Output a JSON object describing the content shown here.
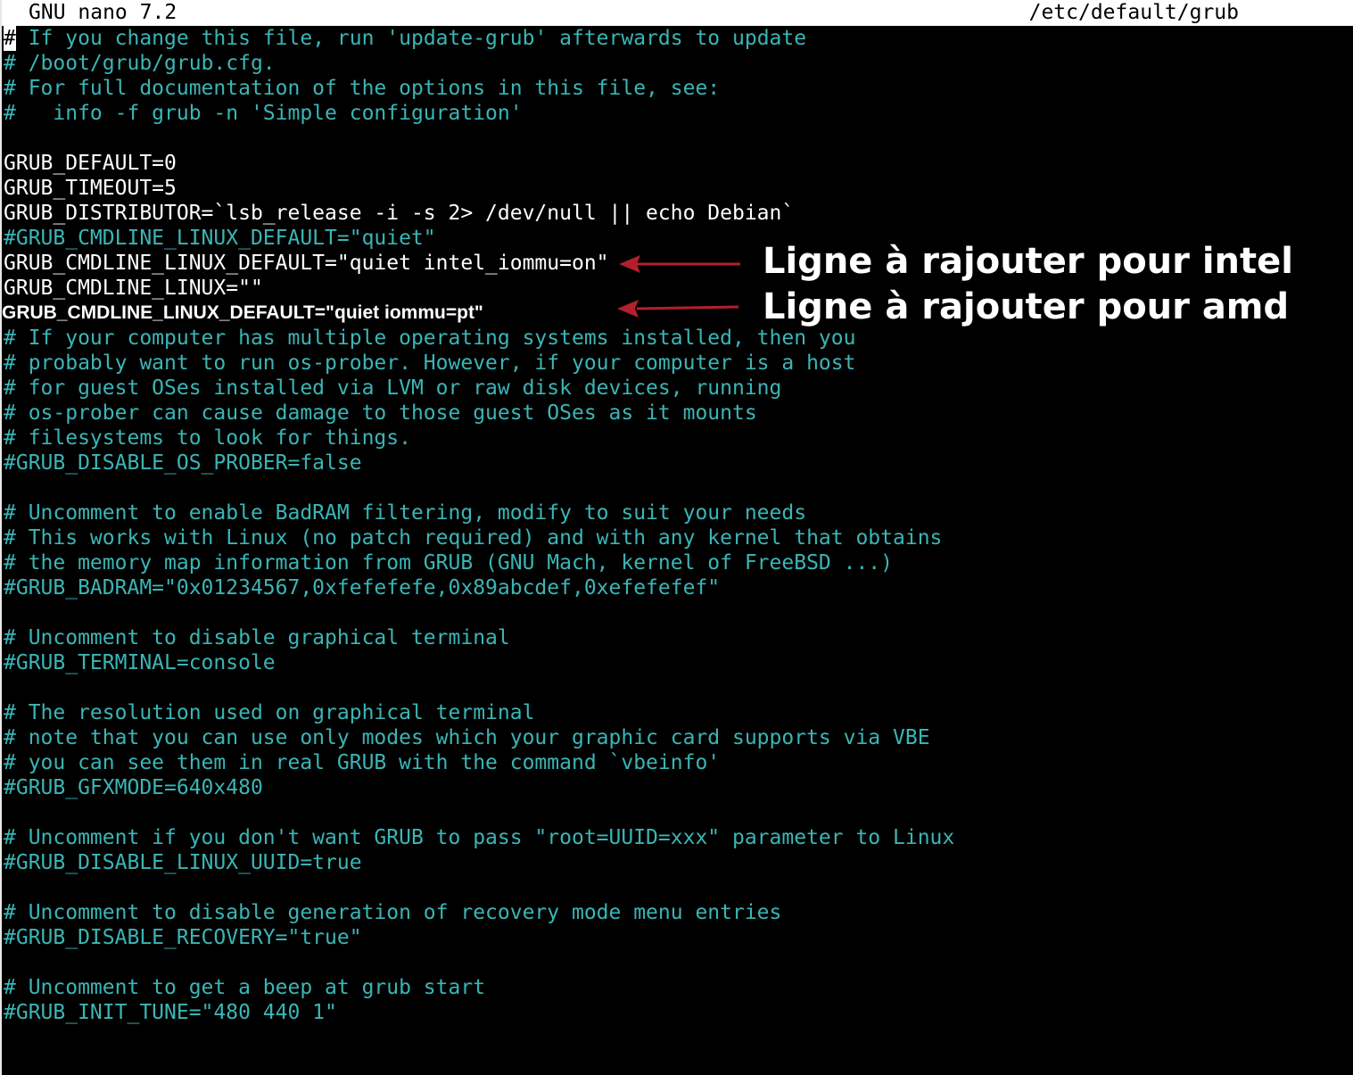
{
  "titlebar": {
    "app_name": "GNU nano 7.2",
    "file_path": "/etc/default/grub"
  },
  "editor": {
    "first_char": "#",
    "first_line_rest": " If you change this file, run 'update-grub' afterwards to update",
    "lines": [
      {
        "kind": "comment",
        "text": "# /boot/grub/grub.cfg."
      },
      {
        "kind": "comment",
        "text": "# For full documentation of the options in this file, see:"
      },
      {
        "kind": "comment",
        "text": "#   info -f grub -n 'Simple configuration'"
      },
      {
        "kind": "blank",
        "text": ""
      },
      {
        "kind": "plain",
        "text": "GRUB_DEFAULT=0"
      },
      {
        "kind": "plain",
        "text": "GRUB_TIMEOUT=5"
      },
      {
        "kind": "plain",
        "text": "GRUB_DISTRIBUTOR=`lsb_release -i -s 2> /dev/null || echo Debian`"
      },
      {
        "kind": "comment",
        "text": "#GRUB_CMDLINE_LINUX_DEFAULT=\"quiet\""
      },
      {
        "kind": "plain",
        "text": "GRUB_CMDLINE_LINUX_DEFAULT=\"quiet intel_iommu=on\""
      },
      {
        "kind": "plain",
        "text": "GRUB_CMDLINE_LINUX=\"\""
      },
      {
        "kind": "added",
        "text": "GRUB_CMDLINE_LINUX_DEFAULT=\"quiet iommu=pt\""
      },
      {
        "kind": "comment",
        "text": "# If your computer has multiple operating systems installed, then you"
      },
      {
        "kind": "comment",
        "text": "# probably want to run os-prober. However, if your computer is a host"
      },
      {
        "kind": "comment",
        "text": "# for guest OSes installed via LVM or raw disk devices, running"
      },
      {
        "kind": "comment",
        "text": "# os-prober can cause damage to those guest OSes as it mounts"
      },
      {
        "kind": "comment",
        "text": "# filesystems to look for things."
      },
      {
        "kind": "comment",
        "text": "#GRUB_DISABLE_OS_PROBER=false"
      },
      {
        "kind": "blank",
        "text": ""
      },
      {
        "kind": "comment",
        "text": "# Uncomment to enable BadRAM filtering, modify to suit your needs"
      },
      {
        "kind": "comment",
        "text": "# This works with Linux (no patch required) and with any kernel that obtains"
      },
      {
        "kind": "comment",
        "text": "# the memory map information from GRUB (GNU Mach, kernel of FreeBSD ...)"
      },
      {
        "kind": "comment",
        "text": "#GRUB_BADRAM=\"0x01234567,0xfefefefe,0x89abcdef,0xefefefef\""
      },
      {
        "kind": "blank",
        "text": ""
      },
      {
        "kind": "comment",
        "text": "# Uncomment to disable graphical terminal"
      },
      {
        "kind": "comment",
        "text": "#GRUB_TERMINAL=console"
      },
      {
        "kind": "blank",
        "text": ""
      },
      {
        "kind": "comment",
        "text": "# The resolution used on graphical terminal"
      },
      {
        "kind": "comment",
        "text": "# note that you can use only modes which your graphic card supports via VBE"
      },
      {
        "kind": "comment",
        "text": "# you can see them in real GRUB with the command `vbeinfo'"
      },
      {
        "kind": "comment",
        "text": "#GRUB_GFXMODE=640x480"
      },
      {
        "kind": "blank",
        "text": ""
      },
      {
        "kind": "comment",
        "text": "# Uncomment if you don't want GRUB to pass \"root=UUID=xxx\" parameter to Linux"
      },
      {
        "kind": "comment",
        "text": "#GRUB_DISABLE_LINUX_UUID=true"
      },
      {
        "kind": "blank",
        "text": ""
      },
      {
        "kind": "comment",
        "text": "# Uncomment to disable generation of recovery mode menu entries"
      },
      {
        "kind": "comment",
        "text": "#GRUB_DISABLE_RECOVERY=\"true\""
      },
      {
        "kind": "blank",
        "text": ""
      },
      {
        "kind": "comment",
        "text": "# Uncomment to get a beep at grub start"
      },
      {
        "kind": "comment",
        "text": "#GRUB_INIT_TUNE=\"480 440 1\""
      }
    ]
  },
  "annotations": {
    "intel": "Ligne à rajouter pour intel",
    "amd": "Ligne à rajouter pour amd"
  },
  "colors": {
    "background": "#000000",
    "comment": "#3bb5b5",
    "plain_text": "#ffffff",
    "titlebar_bg": "#ffffff",
    "arrow": "#b3202a"
  }
}
